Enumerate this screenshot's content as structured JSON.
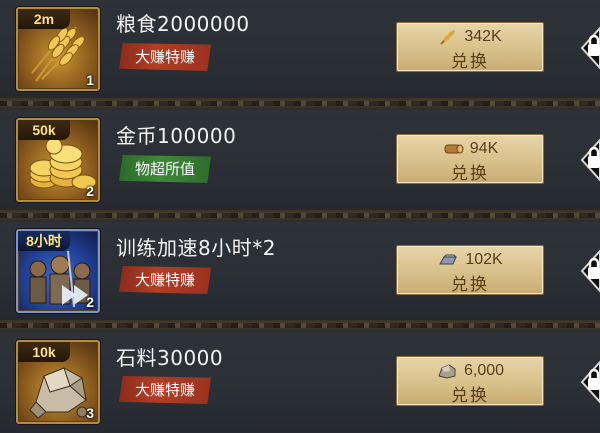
{
  "items": [
    {
      "qty_tag": "2m",
      "icon": "wheat-icon",
      "count": "1",
      "title": "粮食2000000",
      "badge": "大赚特赚",
      "badge_color": "#b23e24",
      "cost_icon": "wheat-currency-icon",
      "cost": "342K",
      "button_label": "兑换"
    },
    {
      "qty_tag": "50k",
      "icon": "gold-coins-icon",
      "count": "2",
      "title": "金币100000",
      "badge": "物超所值",
      "badge_color": "#3e8a38",
      "cost_icon": "wood-log-icon",
      "cost": "94K",
      "button_label": "兑换"
    },
    {
      "qty_tag": "8小时",
      "icon": "training-speedup-icon",
      "count": "2",
      "title": "训练加速8小时*2",
      "badge": "大赚特赚",
      "badge_color": "#b23e24",
      "cost_icon": "iron-ingot-icon",
      "cost": "102K",
      "button_label": "兑换"
    },
    {
      "qty_tag": "10k",
      "icon": "stone-icon",
      "count": "3",
      "title": "石料30000",
      "badge": "大赚特赚",
      "badge_color": "#b23e24",
      "cost_icon": "stone-ore-icon",
      "cost": "6,000",
      "button_label": "兑换"
    }
  ]
}
